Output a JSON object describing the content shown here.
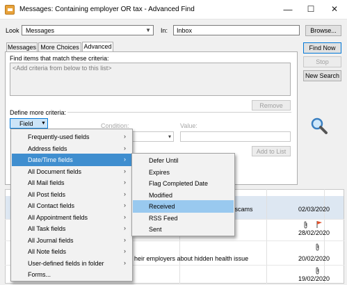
{
  "window": {
    "title": "Messages: Containing employer OR tax - Advanced Find",
    "minimize": "—",
    "maximize": "☐",
    "close": "✕"
  },
  "look": {
    "label": "Look",
    "value": "Messages",
    "in_label": "In:",
    "in_value": "Inbox"
  },
  "tabs": [
    "Messages",
    "More Choices",
    "Advanced"
  ],
  "advanced": {
    "find_items_label": "Find items that match these criteria:",
    "criteria_placeholder": "<Add criteria from below to this list>",
    "remove": "Remove",
    "define_more": "Define more criteria:",
    "field_button": "Field",
    "condition_label": "Condition:",
    "value_label": "Value:",
    "add_to_list": "Add to List"
  },
  "buttons": {
    "browse": "Browse...",
    "find_now": "Find Now",
    "stop": "Stop",
    "new_search": "New Search"
  },
  "field_menu": [
    "Frequently-used fields",
    "Address fields",
    "Date/Time fields",
    "All Document fields",
    "All Mail fields",
    "All Post fields",
    "All Contact fields",
    "All Appointment fields",
    "All Task fields",
    "All Journal fields",
    "All Note fields",
    "User-defined fields in folder",
    "Forms..."
  ],
  "submenu_chevron": "›",
  "datetime_submenu": [
    "Defer Until",
    "Expires",
    "Flag Completed Date",
    "Modified",
    "Received",
    "RSS Feed",
    "Sent"
  ],
  "results": {
    "row1_subject": "phone scams",
    "row1_date": "02/03/2020",
    "row2_date": "28/02/2020",
    "row3_subject": "heir employers about hidden health issue",
    "row3_date": "20/02/2020",
    "row4_date": "19/02/2020"
  },
  "colors": {
    "highlight": "#3f8ecf",
    "selected_submenu": "#99c9ef",
    "flag": "#e0522d"
  }
}
